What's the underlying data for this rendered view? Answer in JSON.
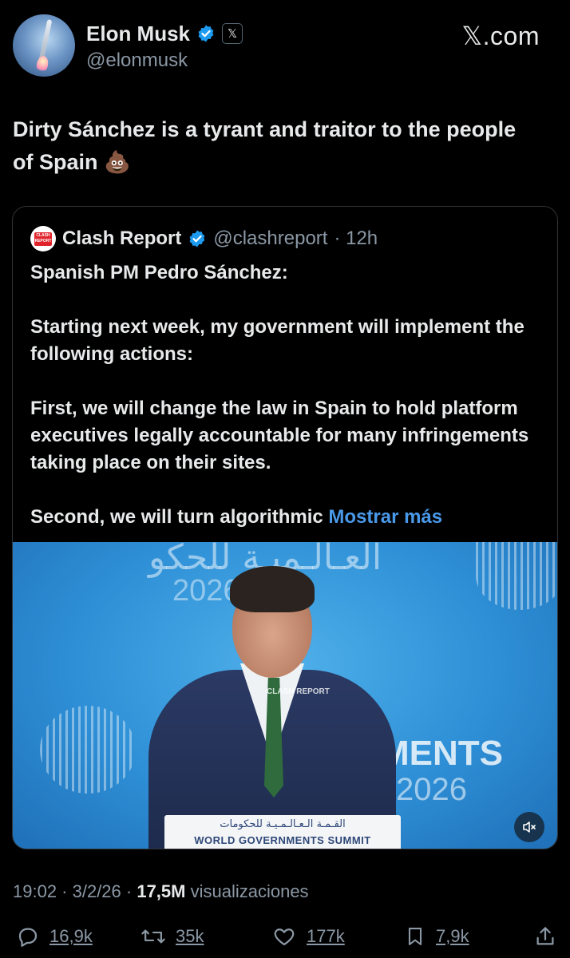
{
  "author": {
    "name": "Elon Musk",
    "handle": "@elonmusk",
    "verified_icon": "verified-badge-icon",
    "affiliation_icon": "x-affiliation-icon"
  },
  "brand": "𝕏.com",
  "tweet": {
    "text": "Dirty Sánchez is a tyrant and traitor to the people of Spain 💩"
  },
  "quote": {
    "name": "Clash Report",
    "handle": "@clashreport",
    "time": "· 12h",
    "paragraphs": [
      "Spanish PM Pedro Sánchez:",
      "Starting next week, my government will implement the following actions:",
      "First, we will change the law in Spain to hold platform executives legally accountable for many infringements taking place on their sites."
    ],
    "last_line": "Second, we will turn algorithmic ",
    "show_more": "Mostrar más",
    "logo_text": "CLASH REPORT",
    "media": {
      "arabic_top": "العـالـميـة للحكو",
      "year_left": "2026",
      "ments": "MENTS",
      "year_right": "2026",
      "lectern_arabic": "القـمـة الـعـالـمـيـة للحكومات",
      "lectern_english": "WORLD GOVERNMENTS SUMMIT",
      "watermark": "CLASH REPORT"
    }
  },
  "meta": {
    "time_date": "19:02 · 3/2/26 · ",
    "views_count": "17,5M",
    "views_label": " visualizaciones"
  },
  "actions": {
    "replies": "16,9k",
    "reposts": "35k",
    "likes": "177k",
    "bookmarks": "7,9k"
  },
  "colors": {
    "background": "#000000",
    "text": "#e7e9ea",
    "secondary": "#8b98a5",
    "link": "#4a99e9",
    "verified": "#1d9bf0"
  }
}
